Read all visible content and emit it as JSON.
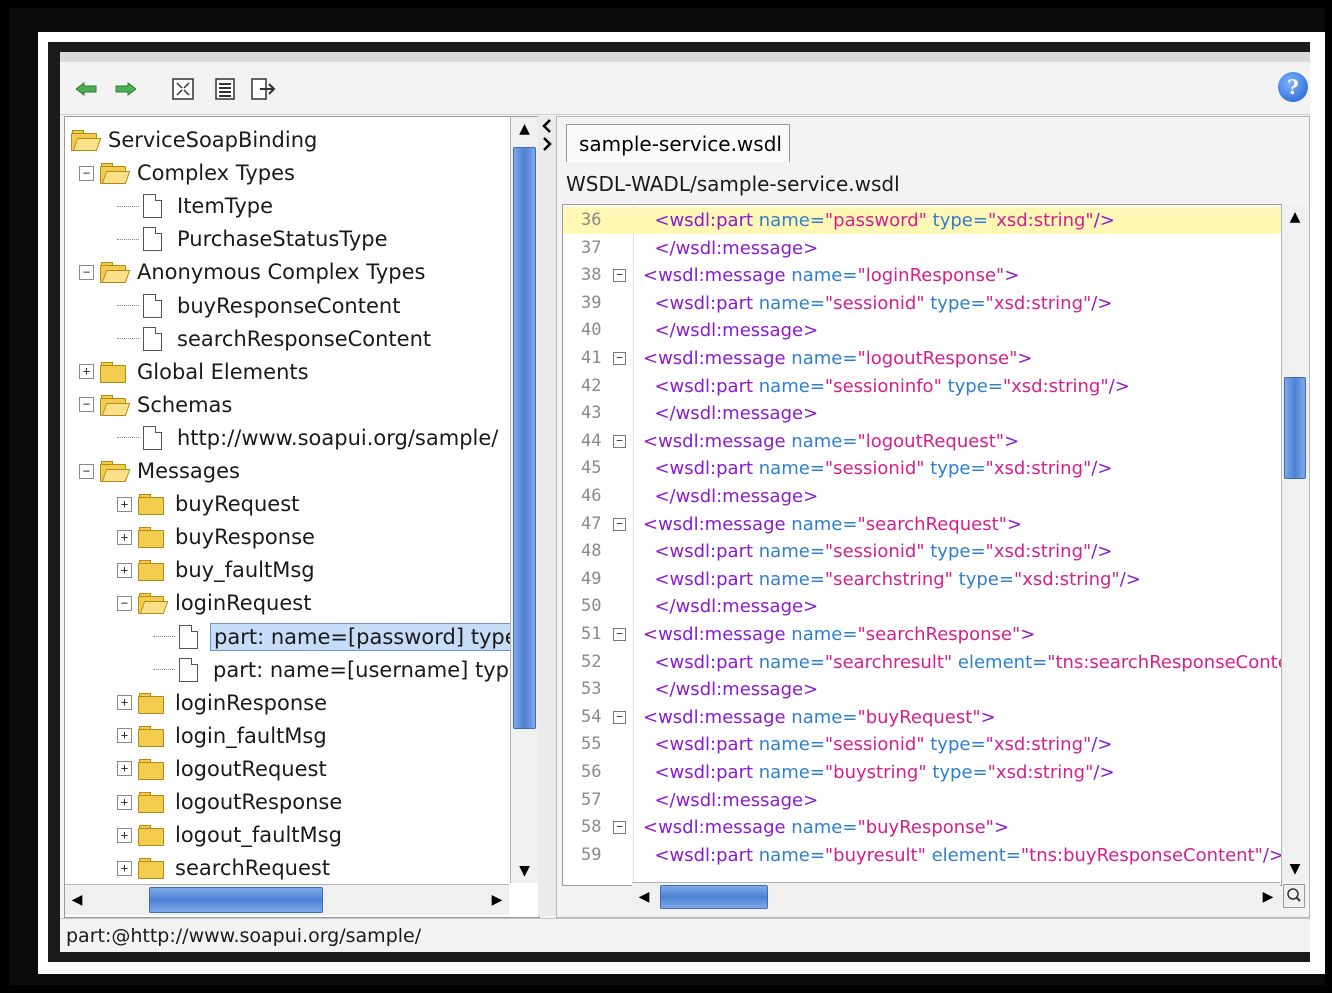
{
  "toolbar": {
    "back_icon": "back-arrow-icon",
    "forward_icon": "forward-arrow-icon",
    "help_label": "?"
  },
  "tree": {
    "items": [
      {
        "label": "ServiceSoapBinding",
        "icon": "folder-open",
        "expander": "",
        "indent": 0
      },
      {
        "label": "Complex Types",
        "icon": "folder-open",
        "expander": "-",
        "indent": 1
      },
      {
        "label": "ItemType",
        "icon": "doc",
        "expander": "",
        "indent": 2
      },
      {
        "label": "PurchaseStatusType",
        "icon": "doc",
        "expander": "",
        "indent": 2
      },
      {
        "label": "Anonymous Complex Types",
        "icon": "folder-open",
        "expander": "-",
        "indent": 1
      },
      {
        "label": "buyResponseContent",
        "icon": "doc",
        "expander": "",
        "indent": 2
      },
      {
        "label": "searchResponseContent",
        "icon": "doc",
        "expander": "",
        "indent": 2
      },
      {
        "label": "Global Elements",
        "icon": "folder",
        "expander": "+",
        "indent": 1
      },
      {
        "label": "Schemas",
        "icon": "folder-open",
        "expander": "-",
        "indent": 1
      },
      {
        "label": "http://www.soapui.org/sample/",
        "icon": "doc",
        "expander": "",
        "indent": 2
      },
      {
        "label": "Messages",
        "icon": "folder-open",
        "expander": "-",
        "indent": 1
      },
      {
        "label": "buyRequest",
        "icon": "folder",
        "expander": "+",
        "indent": 2
      },
      {
        "label": "buyResponse",
        "icon": "folder",
        "expander": "+",
        "indent": 2
      },
      {
        "label": "buy_faultMsg",
        "icon": "folder",
        "expander": "+",
        "indent": 2
      },
      {
        "label": "loginRequest",
        "icon": "folder-open",
        "expander": "-",
        "indent": 2
      },
      {
        "label": "part: name=[password] type=",
        "icon": "doc",
        "expander": "",
        "indent": 3,
        "selected": true
      },
      {
        "label": "part: name=[username] type=",
        "icon": "doc",
        "expander": "",
        "indent": 3
      },
      {
        "label": "loginResponse",
        "icon": "folder",
        "expander": "+",
        "indent": 2
      },
      {
        "label": "login_faultMsg",
        "icon": "folder",
        "expander": "+",
        "indent": 2
      },
      {
        "label": "logoutRequest",
        "icon": "folder",
        "expander": "+",
        "indent": 2
      },
      {
        "label": "logoutResponse",
        "icon": "folder",
        "expander": "+",
        "indent": 2
      },
      {
        "label": "logout_faultMsg",
        "icon": "folder",
        "expander": "+",
        "indent": 2
      },
      {
        "label": "searchRequest",
        "icon": "folder",
        "expander": "+",
        "indent": 2
      }
    ]
  },
  "editor": {
    "tab_label": "sample-service.wsdl",
    "path": "WSDL-WADL/sample-service.wsdl",
    "lines": [
      {
        "n": "36",
        "fold": false,
        "hl": true,
        "parts": [
          [
            "tg",
            "  <wsdl:part "
          ],
          [
            "at",
            "name="
          ],
          [
            "vl",
            "\"password\""
          ],
          [
            "at",
            " type="
          ],
          [
            "vl",
            "\"xsd:string\""
          ],
          [
            "tg",
            "/>"
          ]
        ]
      },
      {
        "n": "37",
        "fold": false,
        "parts": [
          [
            "tg",
            "  </wsdl:message>"
          ]
        ]
      },
      {
        "n": "38",
        "fold": true,
        "parts": [
          [
            "tg",
            "<wsdl:message "
          ],
          [
            "at",
            "name="
          ],
          [
            "vl",
            "\"loginResponse\""
          ],
          [
            "tg",
            ">"
          ]
        ]
      },
      {
        "n": "39",
        "fold": false,
        "parts": [
          [
            "tg",
            "  <wsdl:part "
          ],
          [
            "at",
            "name="
          ],
          [
            "vl",
            "\"sessionid\""
          ],
          [
            "at",
            " type="
          ],
          [
            "vl",
            "\"xsd:string\""
          ],
          [
            "tg",
            "/>"
          ]
        ]
      },
      {
        "n": "40",
        "fold": false,
        "parts": [
          [
            "tg",
            "  </wsdl:message>"
          ]
        ]
      },
      {
        "n": "41",
        "fold": true,
        "parts": [
          [
            "tg",
            "<wsdl:message "
          ],
          [
            "at",
            "name="
          ],
          [
            "vl",
            "\"logoutResponse\""
          ],
          [
            "tg",
            ">"
          ]
        ]
      },
      {
        "n": "42",
        "fold": false,
        "parts": [
          [
            "tg",
            "  <wsdl:part "
          ],
          [
            "at",
            "name="
          ],
          [
            "vl",
            "\"sessioninfo\""
          ],
          [
            "at",
            " type="
          ],
          [
            "vl",
            "\"xsd:string\""
          ],
          [
            "tg",
            "/>"
          ]
        ]
      },
      {
        "n": "43",
        "fold": false,
        "parts": [
          [
            "tg",
            "  </wsdl:message>"
          ]
        ]
      },
      {
        "n": "44",
        "fold": true,
        "parts": [
          [
            "tg",
            "<wsdl:message "
          ],
          [
            "at",
            "name="
          ],
          [
            "vl",
            "\"logoutRequest\""
          ],
          [
            "tg",
            ">"
          ]
        ]
      },
      {
        "n": "45",
        "fold": false,
        "parts": [
          [
            "tg",
            "  <wsdl:part "
          ],
          [
            "at",
            "name="
          ],
          [
            "vl",
            "\"sessionid\""
          ],
          [
            "at",
            " type="
          ],
          [
            "vl",
            "\"xsd:string\""
          ],
          [
            "tg",
            "/>"
          ]
        ]
      },
      {
        "n": "46",
        "fold": false,
        "parts": [
          [
            "tg",
            "  </wsdl:message>"
          ]
        ]
      },
      {
        "n": "47",
        "fold": true,
        "parts": [
          [
            "tg",
            "<wsdl:message "
          ],
          [
            "at",
            "name="
          ],
          [
            "vl",
            "\"searchRequest\""
          ],
          [
            "tg",
            ">"
          ]
        ]
      },
      {
        "n": "48",
        "fold": false,
        "parts": [
          [
            "tg",
            "  <wsdl:part "
          ],
          [
            "at",
            "name="
          ],
          [
            "vl",
            "\"sessionid\""
          ],
          [
            "at",
            " type="
          ],
          [
            "vl",
            "\"xsd:string\""
          ],
          [
            "tg",
            "/>"
          ]
        ]
      },
      {
        "n": "49",
        "fold": false,
        "parts": [
          [
            "tg",
            "  <wsdl:part "
          ],
          [
            "at",
            "name="
          ],
          [
            "vl",
            "\"searchstring\""
          ],
          [
            "at",
            " type="
          ],
          [
            "vl",
            "\"xsd:string\""
          ],
          [
            "tg",
            "/>"
          ]
        ]
      },
      {
        "n": "50",
        "fold": false,
        "parts": [
          [
            "tg",
            "  </wsdl:message>"
          ]
        ]
      },
      {
        "n": "51",
        "fold": true,
        "parts": [
          [
            "tg",
            "<wsdl:message "
          ],
          [
            "at",
            "name="
          ],
          [
            "vl",
            "\"searchResponse\""
          ],
          [
            "tg",
            ">"
          ]
        ]
      },
      {
        "n": "52",
        "fold": false,
        "parts": [
          [
            "tg",
            "  <wsdl:part "
          ],
          [
            "at",
            "name="
          ],
          [
            "vl",
            "\"searchresult\""
          ],
          [
            "at",
            " element="
          ],
          [
            "vl",
            "\"tns:searchResponseConte"
          ]
        ]
      },
      {
        "n": "53",
        "fold": false,
        "parts": [
          [
            "tg",
            "  </wsdl:message>"
          ]
        ]
      },
      {
        "n": "54",
        "fold": true,
        "parts": [
          [
            "tg",
            "<wsdl:message "
          ],
          [
            "at",
            "name="
          ],
          [
            "vl",
            "\"buyRequest\""
          ],
          [
            "tg",
            ">"
          ]
        ]
      },
      {
        "n": "55",
        "fold": false,
        "parts": [
          [
            "tg",
            "  <wsdl:part "
          ],
          [
            "at",
            "name="
          ],
          [
            "vl",
            "\"sessionid\""
          ],
          [
            "at",
            " type="
          ],
          [
            "vl",
            "\"xsd:string\""
          ],
          [
            "tg",
            "/>"
          ]
        ]
      },
      {
        "n": "56",
        "fold": false,
        "parts": [
          [
            "tg",
            "  <wsdl:part "
          ],
          [
            "at",
            "name="
          ],
          [
            "vl",
            "\"buystring\""
          ],
          [
            "at",
            " type="
          ],
          [
            "vl",
            "\"xsd:string\""
          ],
          [
            "tg",
            "/>"
          ]
        ]
      },
      {
        "n": "57",
        "fold": false,
        "parts": [
          [
            "tg",
            "  </wsdl:message>"
          ]
        ]
      },
      {
        "n": "58",
        "fold": true,
        "parts": [
          [
            "tg",
            "<wsdl:message "
          ],
          [
            "at",
            "name="
          ],
          [
            "vl",
            "\"buyResponse\""
          ],
          [
            "tg",
            ">"
          ]
        ]
      },
      {
        "n": "59",
        "fold": false,
        "parts": [
          [
            "tg",
            "  <wsdl:part "
          ],
          [
            "at",
            "name="
          ],
          [
            "vl",
            "\"buyresult\""
          ],
          [
            "at",
            " element="
          ],
          [
            "vl",
            "\"tns:buyResponseContent\""
          ],
          [
            "tg",
            "/>"
          ]
        ]
      }
    ]
  },
  "status": {
    "text": "part:@http://www.soapui.org/sample/"
  },
  "colors": {
    "tag": "#8a1bd0",
    "attr": "#2f7fd0",
    "value": "#d4208f",
    "highlight": "#fff8b5",
    "selection": "#c7ddf7"
  }
}
